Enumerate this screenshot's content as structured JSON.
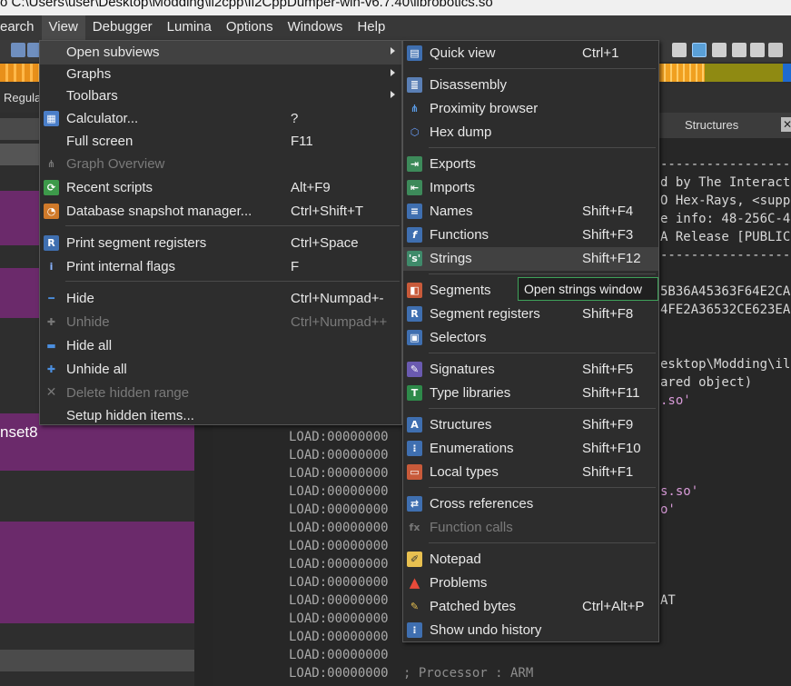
{
  "window": {
    "title": "o C:\\Users\\user\\Desktop\\Modding\\il2cpp\\Il2CppDumper-win-v6.7.40\\librobotics.so"
  },
  "menubar": {
    "items": [
      "earch",
      "View",
      "Debugger",
      "Lumina",
      "Options",
      "Windows",
      "Help"
    ]
  },
  "left_panel": {
    "tab_label": "Regula",
    "visible_text": "nset8"
  },
  "right_tab": {
    "label": "Structures",
    "close": "✕"
  },
  "view_menu": {
    "items": [
      {
        "label": "Open subviews",
        "shortcut": "",
        "submenu": true,
        "icon": "",
        "highlighted": true
      },
      {
        "label": "Graphs",
        "shortcut": "",
        "submenu": true,
        "icon": ""
      },
      {
        "label": "Toolbars",
        "shortcut": "",
        "submenu": true,
        "icon": ""
      },
      {
        "label": "Calculator...",
        "shortcut": "?",
        "icon": "calculator-icon"
      },
      {
        "label": "Full screen",
        "shortcut": "F11",
        "icon": ""
      },
      {
        "label": "Graph Overview",
        "shortcut": "",
        "icon": "graph-overview-icon",
        "disabled": true
      },
      {
        "label": "Recent scripts",
        "shortcut": "Alt+F9",
        "icon": "recent-scripts-icon"
      },
      {
        "label": "Database snapshot manager...",
        "shortcut": "Ctrl+Shift+T",
        "icon": "snapshot-icon"
      },
      {
        "label": "Print segment registers",
        "shortcut": "Ctrl+Space",
        "icon": "segment-registers-icon"
      },
      {
        "label": "Print internal flags",
        "shortcut": "F",
        "icon": "internal-flags-icon"
      },
      {
        "label": "Hide",
        "shortcut": "Ctrl+Numpad+-",
        "icon": "hide-icon"
      },
      {
        "label": "Unhide",
        "shortcut": "Ctrl+Numpad++",
        "icon": "unhide-icon",
        "disabled": true
      },
      {
        "label": "Hide all",
        "shortcut": "",
        "icon": "hide-all-icon"
      },
      {
        "label": "Unhide all",
        "shortcut": "",
        "icon": "unhide-all-icon"
      },
      {
        "label": "Delete hidden range",
        "shortcut": "",
        "icon": "delete-icon",
        "disabled": true
      },
      {
        "label": "Setup hidden items...",
        "shortcut": "",
        "icon": ""
      }
    ]
  },
  "subviews_menu": {
    "items": [
      {
        "label": "Quick view",
        "shortcut": "Ctrl+1",
        "icon": "quick-view-icon"
      },
      {
        "label": "Disassembly",
        "shortcut": "",
        "icon": "disassembly-icon"
      },
      {
        "label": "Proximity browser",
        "shortcut": "",
        "icon": "proximity-browser-icon"
      },
      {
        "label": "Hex dump",
        "shortcut": "",
        "icon": "hex-dump-icon"
      },
      {
        "label": "Exports",
        "shortcut": "",
        "icon": "exports-icon"
      },
      {
        "label": "Imports",
        "shortcut": "",
        "icon": "imports-icon"
      },
      {
        "label": "Names",
        "shortcut": "Shift+F4",
        "icon": "names-icon"
      },
      {
        "label": "Functions",
        "shortcut": "Shift+F3",
        "icon": "functions-icon"
      },
      {
        "label": "Strings",
        "shortcut": "Shift+F12",
        "icon": "strings-icon",
        "highlighted": true
      },
      {
        "label": "Segments",
        "shortcut": "",
        "icon": "segments-icon"
      },
      {
        "label": "Segment registers",
        "shortcut": "Shift+F8",
        "icon": "segment-registers-icon"
      },
      {
        "label": "Selectors",
        "shortcut": "",
        "icon": "selectors-icon"
      },
      {
        "label": "Signatures",
        "shortcut": "Shift+F5",
        "icon": "signatures-icon"
      },
      {
        "label": "Type libraries",
        "shortcut": "Shift+F11",
        "icon": "type-libraries-icon"
      },
      {
        "label": "Structures",
        "shortcut": "Shift+F9",
        "icon": "structures-icon"
      },
      {
        "label": "Enumerations",
        "shortcut": "Shift+F10",
        "icon": "enumerations-icon"
      },
      {
        "label": "Local types",
        "shortcut": "Shift+F1",
        "icon": "local-types-icon"
      },
      {
        "label": "Cross references",
        "shortcut": "",
        "icon": "cross-references-icon"
      },
      {
        "label": "Function calls",
        "shortcut": "",
        "icon": "function-calls-icon",
        "disabled": true
      },
      {
        "label": "Notepad",
        "shortcut": "",
        "icon": "notepad-icon"
      },
      {
        "label": "Problems",
        "shortcut": "",
        "icon": "problems-icon"
      },
      {
        "label": "Patched bytes",
        "shortcut": "Ctrl+Alt+P",
        "icon": "patched-bytes-icon"
      },
      {
        "label": "Show undo history",
        "shortcut": "",
        "icon": "undo-history-icon"
      }
    ]
  },
  "tooltip": {
    "text": "Open strings window"
  },
  "listing": {
    "addresses": [
      "LOAD:00000000",
      "LOAD:00000000",
      "LOAD:00000000",
      "LOAD:00000000",
      "LOAD:00000000",
      "LOAD:00000000",
      "LOAD:00000000",
      "LOAD:00000000",
      "LOAD:00000000",
      "LOAD:00000000",
      "LOAD:00000000",
      "LOAD:00000000",
      "LOAD:00000000",
      "LOAD:00000000"
    ],
    "last_address": "LOAD:00000000",
    "last_comment": "; Processor       : ARM",
    "right_fragments": [
      "-----------------",
      "d by The Interact",
      "O Hex-Rays, <supp",
      "e info: 48-256C-4",
      "A Release [PUBLIC",
      "-----------------",
      "5B36A45363F64E2CA",
      "4FE2A36532CE623EA",
      "esktop\\Modding\\il",
      "ared object)",
      ".so'",
      "s.so'",
      "o'",
      "AT"
    ]
  }
}
